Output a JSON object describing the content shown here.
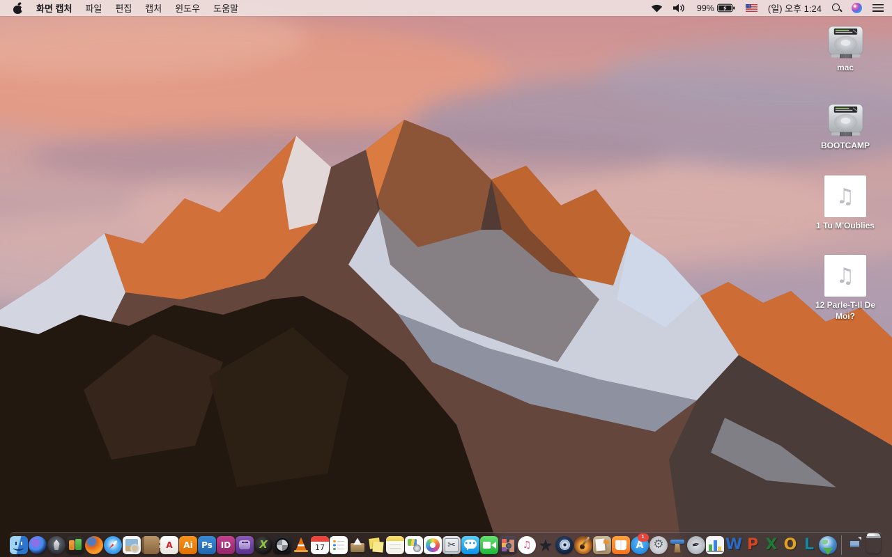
{
  "menu_bar": {
    "apple_menu": "apple-logo",
    "menus": [
      "화면 캡처",
      "파일",
      "편집",
      "캡처",
      "윈도우",
      "도움말"
    ],
    "active_app": "화면 캡처",
    "status": {
      "wifi": "wifi-icon",
      "volume": "speaker-icon",
      "battery_percent": "99%",
      "battery_charging": true,
      "input_source_flag": "us-flag-icon",
      "clock": "(일) 오후 1:24",
      "spotlight": "search-icon",
      "siri": "siri-icon",
      "notification_center": "list-icon"
    }
  },
  "desktop": {
    "icons": [
      {
        "type": "volume",
        "label": "mac"
      },
      {
        "type": "volume",
        "label": "BOOTCAMP"
      },
      {
        "type": "audio",
        "label": "1 Tu M'Oublies"
      },
      {
        "type": "audio",
        "label": "12 Parle-T-Il De Moi?"
      }
    ],
    "audio_note_glyph": "♫"
  },
  "dock": {
    "items": [
      {
        "id": "finder",
        "name": "Finder",
        "shape": "rounded",
        "bg": "linear-gradient(105deg,#9fd2f3 0 48%,#2e75ce 52%)",
        "running": true
      },
      {
        "id": "siri",
        "name": "Siri",
        "shape": "circle",
        "bg": "radial-gradient(circle at 38% 35%,#8e6fe8 0 15%,#3f8ef0 45%,#0d1030 78%)"
      },
      {
        "id": "launchpad",
        "name": "Launchpad",
        "shape": "circle",
        "bg": "radial-gradient(circle at 50% 38%,#70757e,#2c2f36 72%)"
      },
      {
        "id": "screens",
        "name": "Device Screens App",
        "shape": "rounded",
        "bg": "linear-gradient(#32302e,#1c1a19)"
      },
      {
        "id": "firefox",
        "name": "Firefox",
        "shape": "circle",
        "bg": "radial-gradient(circle at 36% 30%,#4f7bc4 0 20%,#e66a17 36%,#f9a12f 68%,#d85a10)"
      },
      {
        "id": "safari",
        "name": "Safari",
        "shape": "circle",
        "bg": "radial-gradient(circle at 50% 45%,#d8eefb 0 10%,#4aa8f0 48%,#1f78d8)"
      },
      {
        "id": "preview",
        "name": "Preview",
        "shape": "rounded",
        "bg": "#f4f5f7"
      },
      {
        "id": "contacts",
        "name": "Contacts",
        "shape": "rounded",
        "bg": "linear-gradient(#b99567,#86643f)"
      },
      {
        "id": "acrobat",
        "name": "Adobe Acrobat Reader",
        "shape": "rounded",
        "bg": "linear-gradient(#ffffff,#e9e5df)",
        "glyph": "A",
        "glyph_color": "#cf1f25"
      },
      {
        "id": "illustrator",
        "name": "Adobe Illustrator",
        "shape": "rounded",
        "bg": "linear-gradient(#f7941e,#df7000)",
        "glyph": "Ai",
        "glyph_color": "#ffffff"
      },
      {
        "id": "photoshop",
        "name": "Adobe Photoshop",
        "shape": "rounded",
        "bg": "linear-gradient(#3b8ad8,#1f66ab)",
        "glyph": "Ps",
        "glyph_color": "#ffffff"
      },
      {
        "id": "indesign",
        "name": "Adobe InDesign",
        "shape": "rounded",
        "bg": "linear-gradient(#c4418f,#92256a)",
        "glyph": "ID",
        "glyph_color": "#ffffff"
      },
      {
        "id": "toast",
        "name": "Toast Titanium",
        "shape": "rounded",
        "bg": "linear-gradient(#8a5bb8,#55308a)"
      },
      {
        "id": "quark",
        "name": "QuarkXPress",
        "shape": "circle",
        "bg": "radial-gradient(circle at 40% 35%,#4c4c4c,#0f0f0f 75%)",
        "glyph": "X",
        "glyph_color": "#8dc63f"
      },
      {
        "id": "diskfan",
        "name": "Disk Tool App",
        "shape": "rounded",
        "bg": "linear-gradient(#2c2c30,#121214)"
      },
      {
        "id": "vlc",
        "name": "VLC Media Player",
        "shape": "free"
      },
      {
        "id": "calendar",
        "name": "Calendar",
        "shape": "rounded",
        "bg": "#fafafa",
        "glyph": "17",
        "glyph_color": "#222222"
      },
      {
        "id": "reminders",
        "name": "Reminders",
        "shape": "rounded",
        "bg": "#ffffff"
      },
      {
        "id": "stuffit",
        "name": "StuffIt Expander",
        "shape": "free"
      },
      {
        "id": "stickies",
        "name": "Stickies",
        "shape": "free"
      },
      {
        "id": "notes",
        "name": "Notes",
        "shape": "rounded",
        "bg": "linear-gradient(#ffffff,#f1eee6)"
      },
      {
        "id": "colorsync",
        "name": "ColorSync Utility",
        "shape": "rounded",
        "bg": "#fbfbfd"
      },
      {
        "id": "photos",
        "name": "Photos",
        "shape": "rounded",
        "bg": "#ffffff"
      },
      {
        "id": "grab",
        "name": "화면 캡처 (Grab)",
        "shape": "rounded",
        "bg": "linear-gradient(#e2e6ea,#b6bcc4)",
        "glyph": "✂",
        "glyph_color": "#3c4148",
        "running": true
      },
      {
        "id": "messages",
        "name": "Messages",
        "shape": "rounded",
        "bg": "linear-gradient(#59cdf7,#0b8fe8)",
        "glyph": "•••",
        "glyph_color": "#2a8fe8"
      },
      {
        "id": "facetime",
        "name": "FaceTime",
        "shape": "rounded",
        "bg": "linear-gradient(#67e06f,#1db53a)"
      },
      {
        "id": "photobooth",
        "name": "Photo Booth",
        "shape": "rounded",
        "bg": "linear-gradient(#4c4752,#2b2730)"
      },
      {
        "id": "itunes",
        "name": "iTunes",
        "shape": "circle",
        "bg": "radial-gradient(circle at 50% 40%,#ffffff 55%,#eceef2)",
        "glyph": "♫",
        "glyph_color": "#e0457b"
      },
      {
        "id": "imovie",
        "name": "iMovie",
        "shape": "free",
        "glyph": "★",
        "glyph_color": "#222228"
      },
      {
        "id": "idvd",
        "name": "iDVD",
        "shape": "circle",
        "bg": "radial-gradient(circle at 45% 38%,#33527c,#101e38 75%)"
      },
      {
        "id": "garageband",
        "name": "GarageBand",
        "shape": "circle",
        "bg": "radial-gradient(circle at 50% 55%,#f2a43c 0 28%,#9a5520 62%,#5e3312)"
      },
      {
        "id": "iweb",
        "name": "Web Documents App",
        "shape": "rounded",
        "bg": "linear-gradient(#ccb998,#a68e69)"
      },
      {
        "id": "ibooks",
        "name": "iBooks",
        "shape": "rounded",
        "bg": "linear-gradient(#ffa23e,#f7741f)"
      },
      {
        "id": "appstore",
        "name": "App Store",
        "shape": "circle",
        "bg": "radial-gradient(circle at 50% 38%,#5fbbf6,#1f86e0 78%)",
        "glyph": "A",
        "glyph_color": "#ffffff",
        "badge": "1"
      },
      {
        "id": "sysprefs",
        "name": "System Preferences",
        "shape": "circle",
        "bg": "radial-gradient(#eceef0,#a9adb4)",
        "glyph": "⚙",
        "glyph_color": "#5d6269"
      },
      {
        "id": "keynote",
        "name": "Keynote",
        "shape": "free"
      },
      {
        "id": "pages",
        "name": "Pages",
        "shape": "circle",
        "bg": "radial-gradient(#e2e5e9,#989ea6)",
        "glyph": "✒",
        "glyph_color": "#2b2f36"
      },
      {
        "id": "numbers",
        "name": "Numbers",
        "shape": "rounded"
      },
      {
        "id": "word",
        "name": "Microsoft Word",
        "shape": "free",
        "glyph": "W",
        "glyph_color": "#2a6ac7"
      },
      {
        "id": "powerpoint",
        "name": "Microsoft PowerPoint",
        "shape": "free",
        "glyph": "P",
        "glyph_color": "#d24726"
      },
      {
        "id": "excel",
        "name": "Microsoft Excel",
        "shape": "free",
        "glyph": "X",
        "glyph_color": "#1e7a34"
      },
      {
        "id": "outlook",
        "name": "Microsoft Outlook",
        "shape": "free",
        "glyph": "O",
        "glyph_color": "#e2a21f"
      },
      {
        "id": "lync",
        "name": "Microsoft Lync",
        "shape": "free",
        "glyph": "L",
        "glyph_color": "#17859e"
      },
      {
        "id": "msupdate",
        "name": "Microsoft Download Globe",
        "shape": "circle",
        "bg": "radial-gradient(circle at 40% 32%,#cfe4f6 0 12%,#4a90d0 48%,#1c4f8a)"
      },
      {
        "divider": true
      },
      {
        "id": "docfile",
        "name": "Image Document File",
        "shape": "free"
      },
      {
        "id": "trash",
        "name": "Trash (full)",
        "shape": "free"
      }
    ]
  },
  "colors": {
    "menubar_bg": "rgba(238,224,222,0.92)",
    "dock_bg": "rgba(66,56,60,0.45)",
    "badge_red": "#e8463c",
    "running_dot": "#141414",
    "desktop_label_text": "#ffffff"
  }
}
